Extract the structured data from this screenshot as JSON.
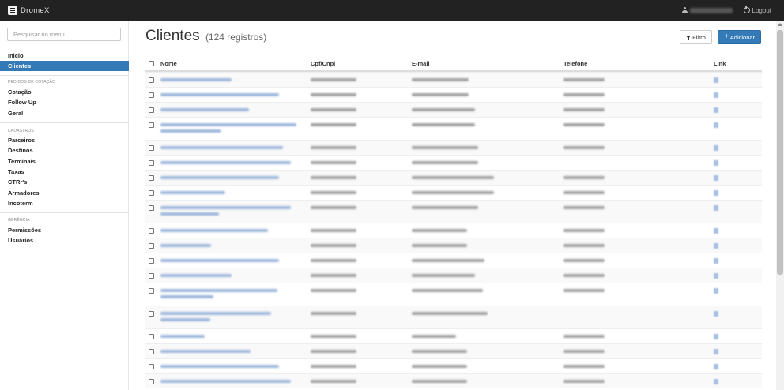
{
  "app": {
    "brand": "DromeX"
  },
  "topbar": {
    "logout_label": "Logout"
  },
  "sidebar": {
    "search_placeholder": "Pesquisar no menu",
    "main_items": [
      {
        "label": "Inicio",
        "active": false
      },
      {
        "label": "Clientes",
        "active": true
      }
    ],
    "sections": [
      {
        "header": "PEDIDOS DE COTAÇÃO",
        "items": [
          {
            "label": "Cotação"
          },
          {
            "label": "Follow Up"
          },
          {
            "label": "Geral"
          }
        ]
      },
      {
        "header": "CADASTROS",
        "items": [
          {
            "label": "Parceiros"
          },
          {
            "label": "Destinos"
          },
          {
            "label": "Terminais"
          },
          {
            "label": "Taxas"
          },
          {
            "label": "CTRr's"
          },
          {
            "label": "Armadores"
          },
          {
            "label": "Incoterm"
          }
        ]
      },
      {
        "header": "GERÊNCIA",
        "items": [
          {
            "label": "Permissões"
          },
          {
            "label": "Usuários"
          }
        ]
      }
    ]
  },
  "page": {
    "title": "Clientes",
    "subtitle": "(124 registros)",
    "filter_label": "Filtro",
    "add_label": "Adicionar"
  },
  "table": {
    "columns": [
      "Nome",
      "Cpf/Cnpj",
      "E-mail",
      "Telefone",
      "Link"
    ]
  },
  "theme": {
    "primary": "#337ab7",
    "topbar": "#222222"
  }
}
